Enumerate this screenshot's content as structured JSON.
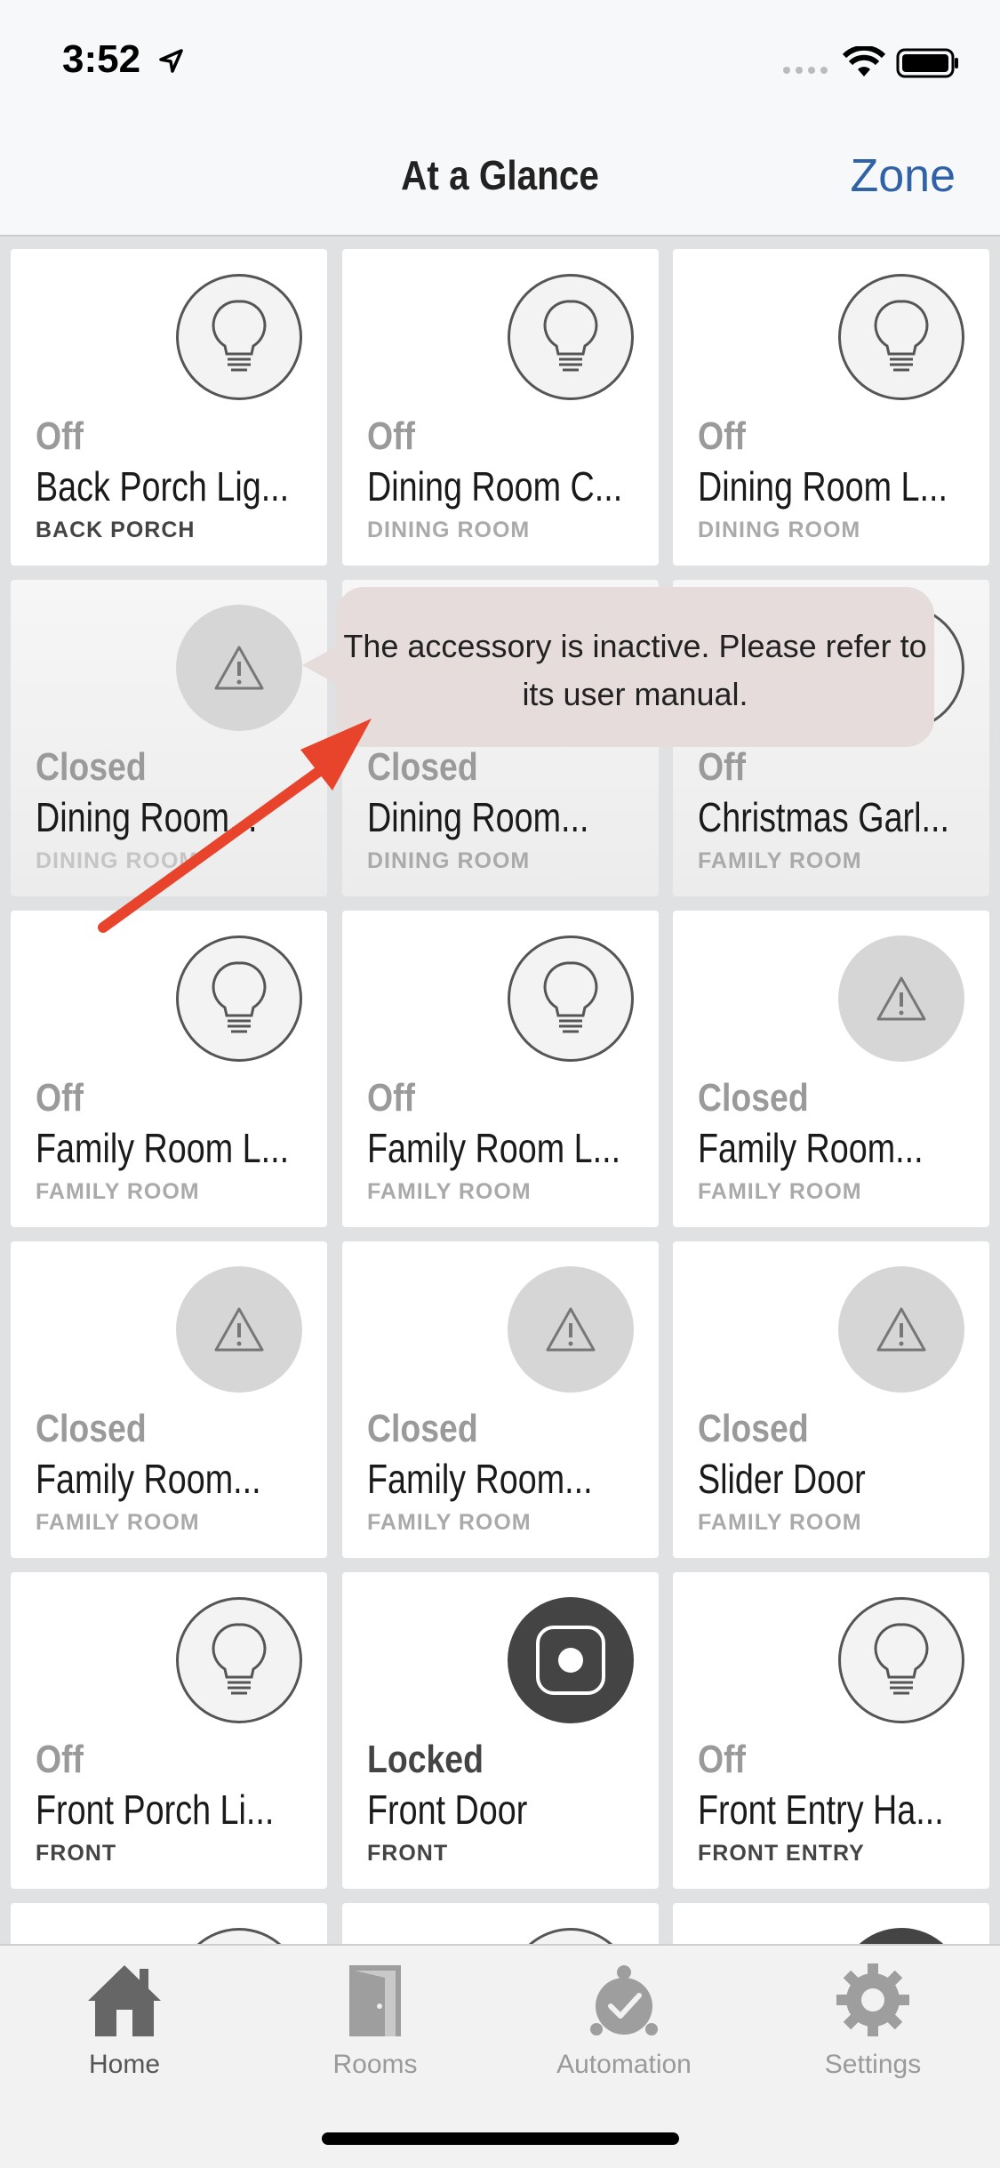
{
  "status_bar": {
    "time": "3:52"
  },
  "nav": {
    "title": "At a Glance",
    "zone_label": "Zone"
  },
  "tiles": [
    {
      "status": "Off",
      "name": "Back Porch Lig...",
      "room": "BACK PORCH",
      "icon": "bulb-icon"
    },
    {
      "status": "Off",
      "name": "Dining Room C...",
      "room": "DINING ROOM",
      "icon": "bulb-icon"
    },
    {
      "status": "Off",
      "name": "Dining Room L...",
      "room": "DINING ROOM",
      "icon": "bulb-icon"
    },
    {
      "status": "Closed",
      "name": "Dining Room...",
      "room": "DINING ROOM",
      "icon": "warning-icon"
    },
    {
      "status": "Closed",
      "name": "Dining Room...",
      "room": "DINING ROOM",
      "icon": "warning-icon"
    },
    {
      "status": "Off",
      "name": "Christmas Garl...",
      "room": "FAMILY ROOM",
      "icon": "bulb-icon"
    },
    {
      "status": "Off",
      "name": "Family Room L...",
      "room": "FAMILY ROOM",
      "icon": "bulb-icon"
    },
    {
      "status": "Off",
      "name": "Family Room L...",
      "room": "FAMILY ROOM",
      "icon": "bulb-icon"
    },
    {
      "status": "Closed",
      "name": "Family Room...",
      "room": "FAMILY ROOM",
      "icon": "warning-icon"
    },
    {
      "status": "Closed",
      "name": "Family Room...",
      "room": "FAMILY ROOM",
      "icon": "warning-icon"
    },
    {
      "status": "Closed",
      "name": "Family Room...",
      "room": "FAMILY ROOM",
      "icon": "warning-icon"
    },
    {
      "status": "Closed",
      "name": "Slider Door",
      "room": "FAMILY ROOM",
      "icon": "warning-icon"
    },
    {
      "status": "Off",
      "name": "Front Porch Li...",
      "room": "FRONT",
      "icon": "bulb-icon"
    },
    {
      "status": "Locked",
      "name": "Front Door",
      "room": "FRONT",
      "icon": "lock-icon"
    },
    {
      "status": "Off",
      "name": "Front Entry Ha...",
      "room": "FRONT ENTRY",
      "icon": "bulb-icon"
    }
  ],
  "tooltip": {
    "text": "The accessory is inactive. Please refer to its user manual."
  },
  "tabs": [
    {
      "label": "Home",
      "icon": "home-icon"
    },
    {
      "label": "Rooms",
      "icon": "door-icon"
    },
    {
      "label": "Automation",
      "icon": "automation-icon"
    },
    {
      "label": "Settings",
      "icon": "gear-icon"
    }
  ],
  "colors": {
    "accent": "#2f62a6",
    "arrow": "#e8442c",
    "tooltip_bg": "#e5dcdb"
  }
}
